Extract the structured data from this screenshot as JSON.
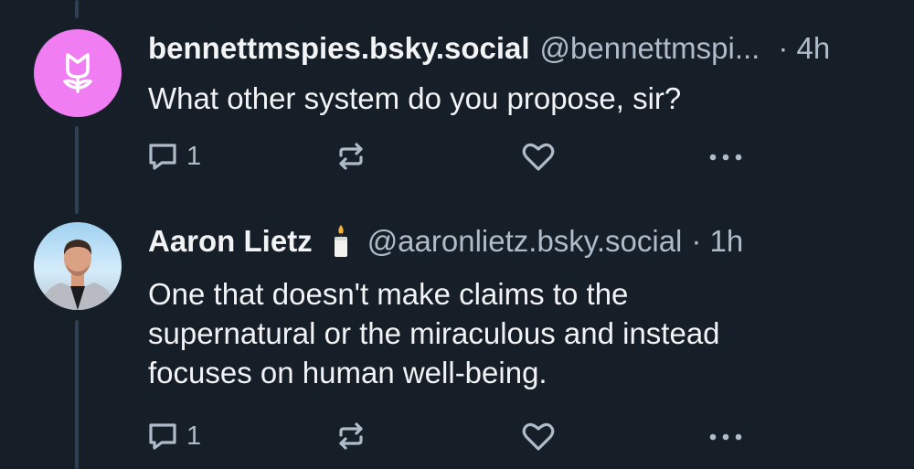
{
  "posts": [
    {
      "display_name": "bennettmspies.bsky.social",
      "handle": "@bennettmspi...",
      "time": "· 4h",
      "text": "What other system do you propose, sir?",
      "reply_count": "1",
      "avatar_icon": "flower-icon"
    },
    {
      "display_name": "Aaron Lietz",
      "name_emoji": "candle",
      "handle": "@aaronlietz.bsky.social",
      "time": "· 1h",
      "text_lines": [
        "One that doesn't make claims to the",
        "supernatural or the miraculous and instead",
        "focuses on human well-being."
      ],
      "reply_count": "1",
      "avatar_icon": "profile-photo"
    }
  ],
  "icons": [
    "reply-icon",
    "repost-icon",
    "like-icon",
    "more-icon"
  ],
  "colors": {
    "background": "#161e27",
    "text": "#f1f3f5",
    "muted": "#aebbc9",
    "thread_line": "#2e4052",
    "flower_avatar": "#f07df2"
  }
}
